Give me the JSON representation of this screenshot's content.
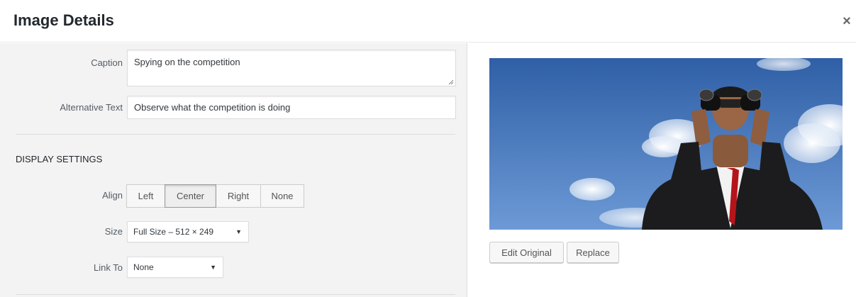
{
  "header": {
    "title": "Image Details",
    "close_glyph": "×"
  },
  "form": {
    "caption_label": "Caption",
    "caption_value": "Spying on the competition",
    "alt_label": "Alternative Text",
    "alt_value": "Observe what the competition is doing"
  },
  "display_settings": {
    "heading": "DISPLAY SETTINGS",
    "align_label": "Align",
    "align_options": [
      "Left",
      "Center",
      "Right",
      "None"
    ],
    "align_selected": "Center",
    "size_label": "Size",
    "size_value": "Full Size – 512 × 249",
    "link_label": "Link To",
    "link_value": "None"
  },
  "preview": {
    "edit_original_label": "Edit Original",
    "replace_label": "Replace"
  },
  "colors": {
    "sky": "#3f6fb3",
    "panel": "#f3f3f3"
  }
}
